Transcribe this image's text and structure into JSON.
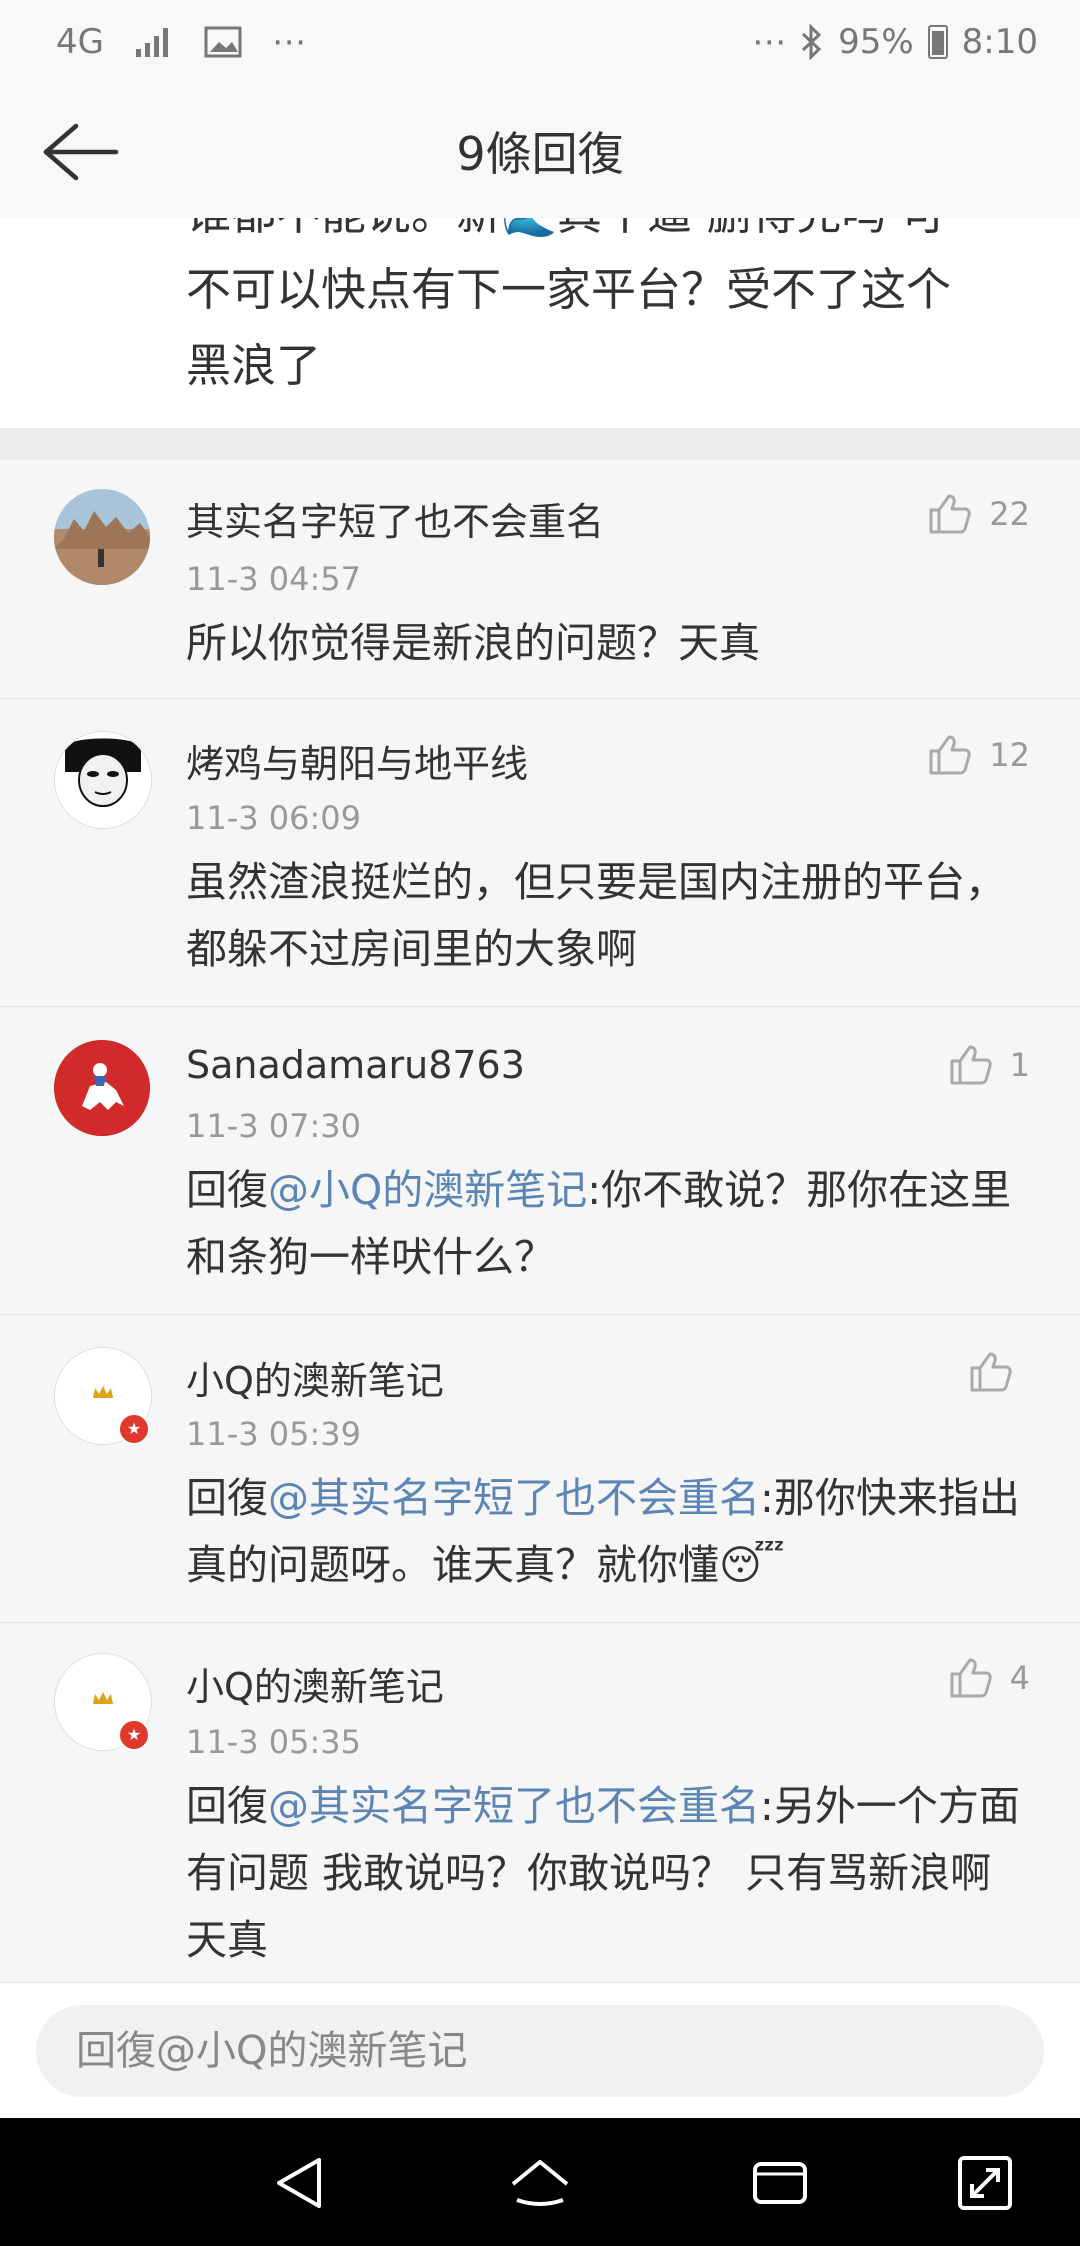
{
  "status": {
    "network": "4G",
    "battery": "95%",
    "time": "8:10"
  },
  "header": {
    "title": "9條回復"
  },
  "post_tail": {
    "line1": "谁都不能说。新🌊真牛逼 删得完吗 可",
    "line2": "不可以快点有下一家平台？受不了这个",
    "line3": "黑浪了"
  },
  "comments": [
    {
      "username": "其实名字短了也不会重名",
      "time": "11-3 04:57",
      "likes": "22",
      "text": "所以你觉得是新浪的问题？天真"
    },
    {
      "username": "烤鸡与朝阳与地平线",
      "time": "11-3 06:09",
      "likes": "12",
      "text": "虽然渣浪挺烂的，但只要是国内注册的平台，都躲不过房间里的大象啊"
    },
    {
      "username": "Sanadamaru8763",
      "time": "11-3 07:30",
      "likes": "1",
      "reply_prefix": "回復",
      "mention": "@小Q的澳新笔记",
      "text": ":你不敢说？那你在这里和条狗一样吠什么？"
    },
    {
      "username": "小Q的澳新笔记",
      "time": "11-3 05:39",
      "likes": "",
      "reply_prefix": "回復",
      "mention": "@其实名字短了也不会重名",
      "text": ":那你快来指出真的问题呀。谁天真？就你懂😴"
    },
    {
      "username": "小Q的澳新笔记",
      "time": "11-3 05:35",
      "likes": "4",
      "reply_prefix": "回復",
      "mention": "@其实名字短了也不会重名",
      "text": ":另外一个方面有问题 我敢说吗？你敢说吗？ 只有骂新浪啊 天真"
    }
  ],
  "input": {
    "placeholder": "回復@小Q的澳新笔记"
  },
  "avatar_badge_glyph": "★",
  "colors": {
    "mention": "#5b85b5",
    "badge": "#e0392c",
    "gap": "#ececec"
  }
}
